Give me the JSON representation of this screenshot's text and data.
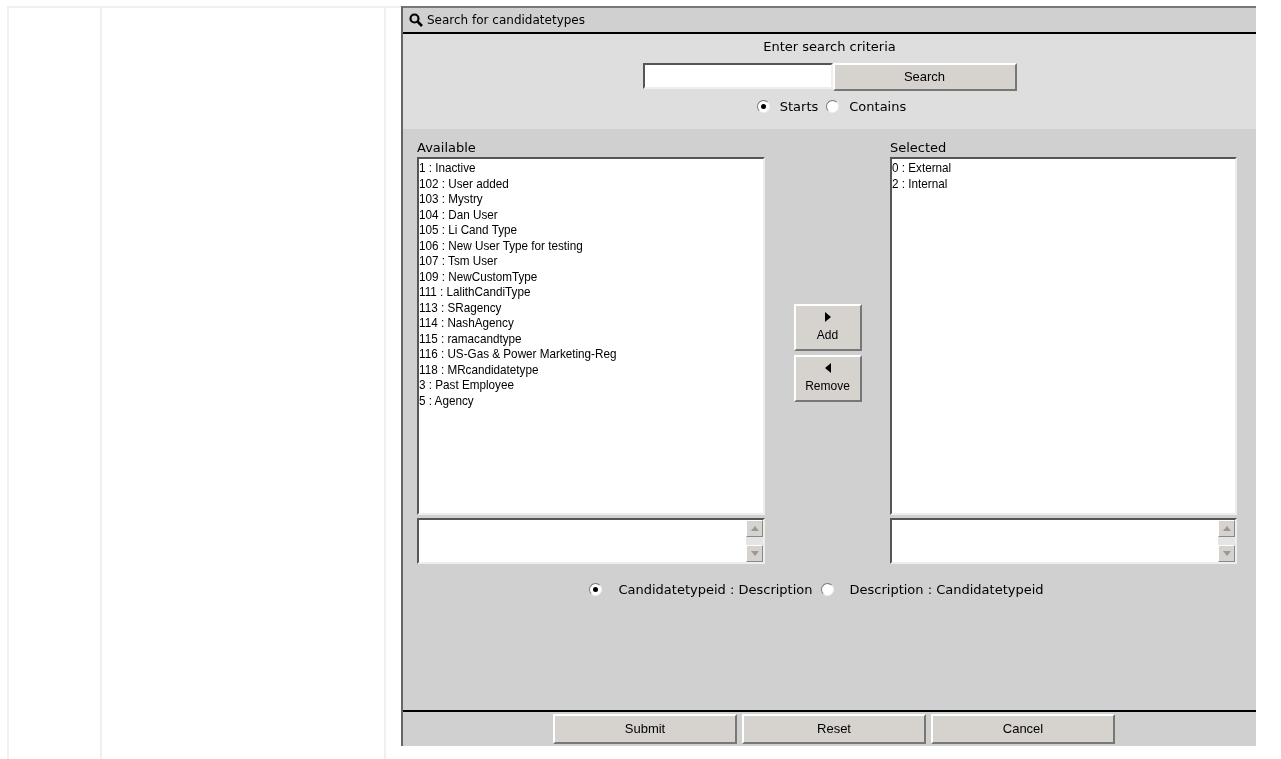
{
  "panel": {
    "title": "Search for candidatetypes"
  },
  "search": {
    "heading": "Enter search criteria",
    "button": "Search",
    "modes": [
      {
        "label": "Starts",
        "selected": true
      },
      {
        "label": "Contains",
        "selected": false
      }
    ]
  },
  "available": {
    "label": "Available",
    "items": [
      "1 : Inactive",
      "102 : User added",
      "103 : Mystry",
      "104 : Dan User",
      "105 : Li Cand Type",
      "106 : New User Type for testing",
      "107 : Tsm User",
      "109 : NewCustomType",
      "111 : LalithCandiType",
      "113 : SRagency",
      "114 : NashAgency",
      "115 : ramacandtype",
      "116 : US-Gas & Power Marketing-Reg",
      "118 : MRcandidatetype",
      "3 : Past Employee",
      "5 : Agency"
    ]
  },
  "transfer_buttons": [
    {
      "label": "Add",
      "kind": "right"
    },
    {
      "label": "Remove",
      "kind": "left"
    }
  ],
  "selected": {
    "label": "Selected",
    "items": [
      "0 : External",
      "2 : Internal"
    ]
  },
  "display_formats": [
    {
      "label": "Candidatetypeid : Description",
      "selected": true
    },
    {
      "label": "Description : Candidatetypeid",
      "selected": false
    }
  ],
  "footer_buttons": [
    "Submit",
    "Reset",
    "Cancel"
  ]
}
